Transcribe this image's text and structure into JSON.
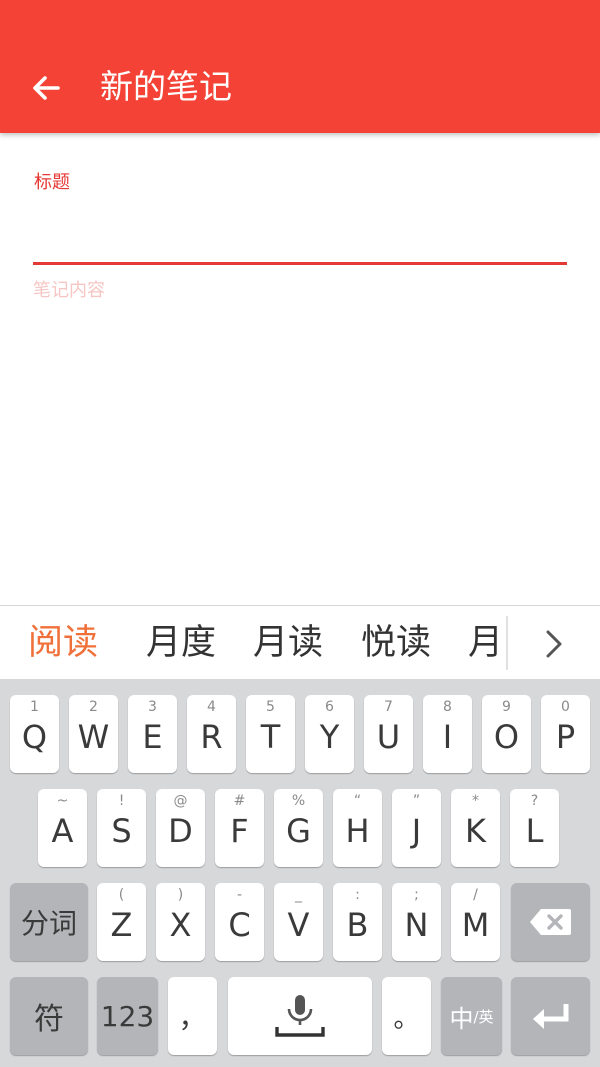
{
  "appbar": {
    "title": "新的笔记",
    "back_icon": "arrow-left-icon"
  },
  "form": {
    "title_label": "标题",
    "title_value": "",
    "content_placeholder": "笔记内容",
    "accent_color": "#E53935"
  },
  "candidates": {
    "items": [
      "阅读",
      "月度",
      "月读",
      "悦读",
      "月"
    ],
    "selected_index": 0,
    "more_icon": "chevron-right-icon"
  },
  "keyboard": {
    "row1": [
      {
        "sub": "1",
        "main": "Q"
      },
      {
        "sub": "2",
        "main": "W"
      },
      {
        "sub": "3",
        "main": "E"
      },
      {
        "sub": "4",
        "main": "R"
      },
      {
        "sub": "5",
        "main": "T"
      },
      {
        "sub": "6",
        "main": "Y"
      },
      {
        "sub": "7",
        "main": "U"
      },
      {
        "sub": "8",
        "main": "I"
      },
      {
        "sub": "9",
        "main": "O"
      },
      {
        "sub": "0",
        "main": "P"
      }
    ],
    "row2": [
      {
        "sub": "~",
        "main": "A"
      },
      {
        "sub": "!",
        "main": "S"
      },
      {
        "sub": "@",
        "main": "D"
      },
      {
        "sub": "#",
        "main": "F"
      },
      {
        "sub": "%",
        "main": "G"
      },
      {
        "sub": "“",
        "main": "H"
      },
      {
        "sub": "”",
        "main": "J"
      },
      {
        "sub": "*",
        "main": "K"
      },
      {
        "sub": "?",
        "main": "L"
      }
    ],
    "row3": [
      {
        "sub": "(",
        "main": "Z"
      },
      {
        "sub": ")",
        "main": "X"
      },
      {
        "sub": "-",
        "main": "C"
      },
      {
        "sub": "_",
        "main": "V"
      },
      {
        "sub": ":",
        "main": "B"
      },
      {
        "sub": ";",
        "main": "N"
      },
      {
        "sub": "/",
        "main": "M"
      }
    ],
    "segment_key": "分词",
    "symbol_key": "符",
    "numbers_key": "123",
    "comma_key": "，",
    "period_key": "。",
    "lang_key_main": "中",
    "lang_key_sub": "/英",
    "mic_icon": "microphone-icon",
    "backspace_icon": "backspace-icon",
    "enter_icon": "enter-icon"
  }
}
